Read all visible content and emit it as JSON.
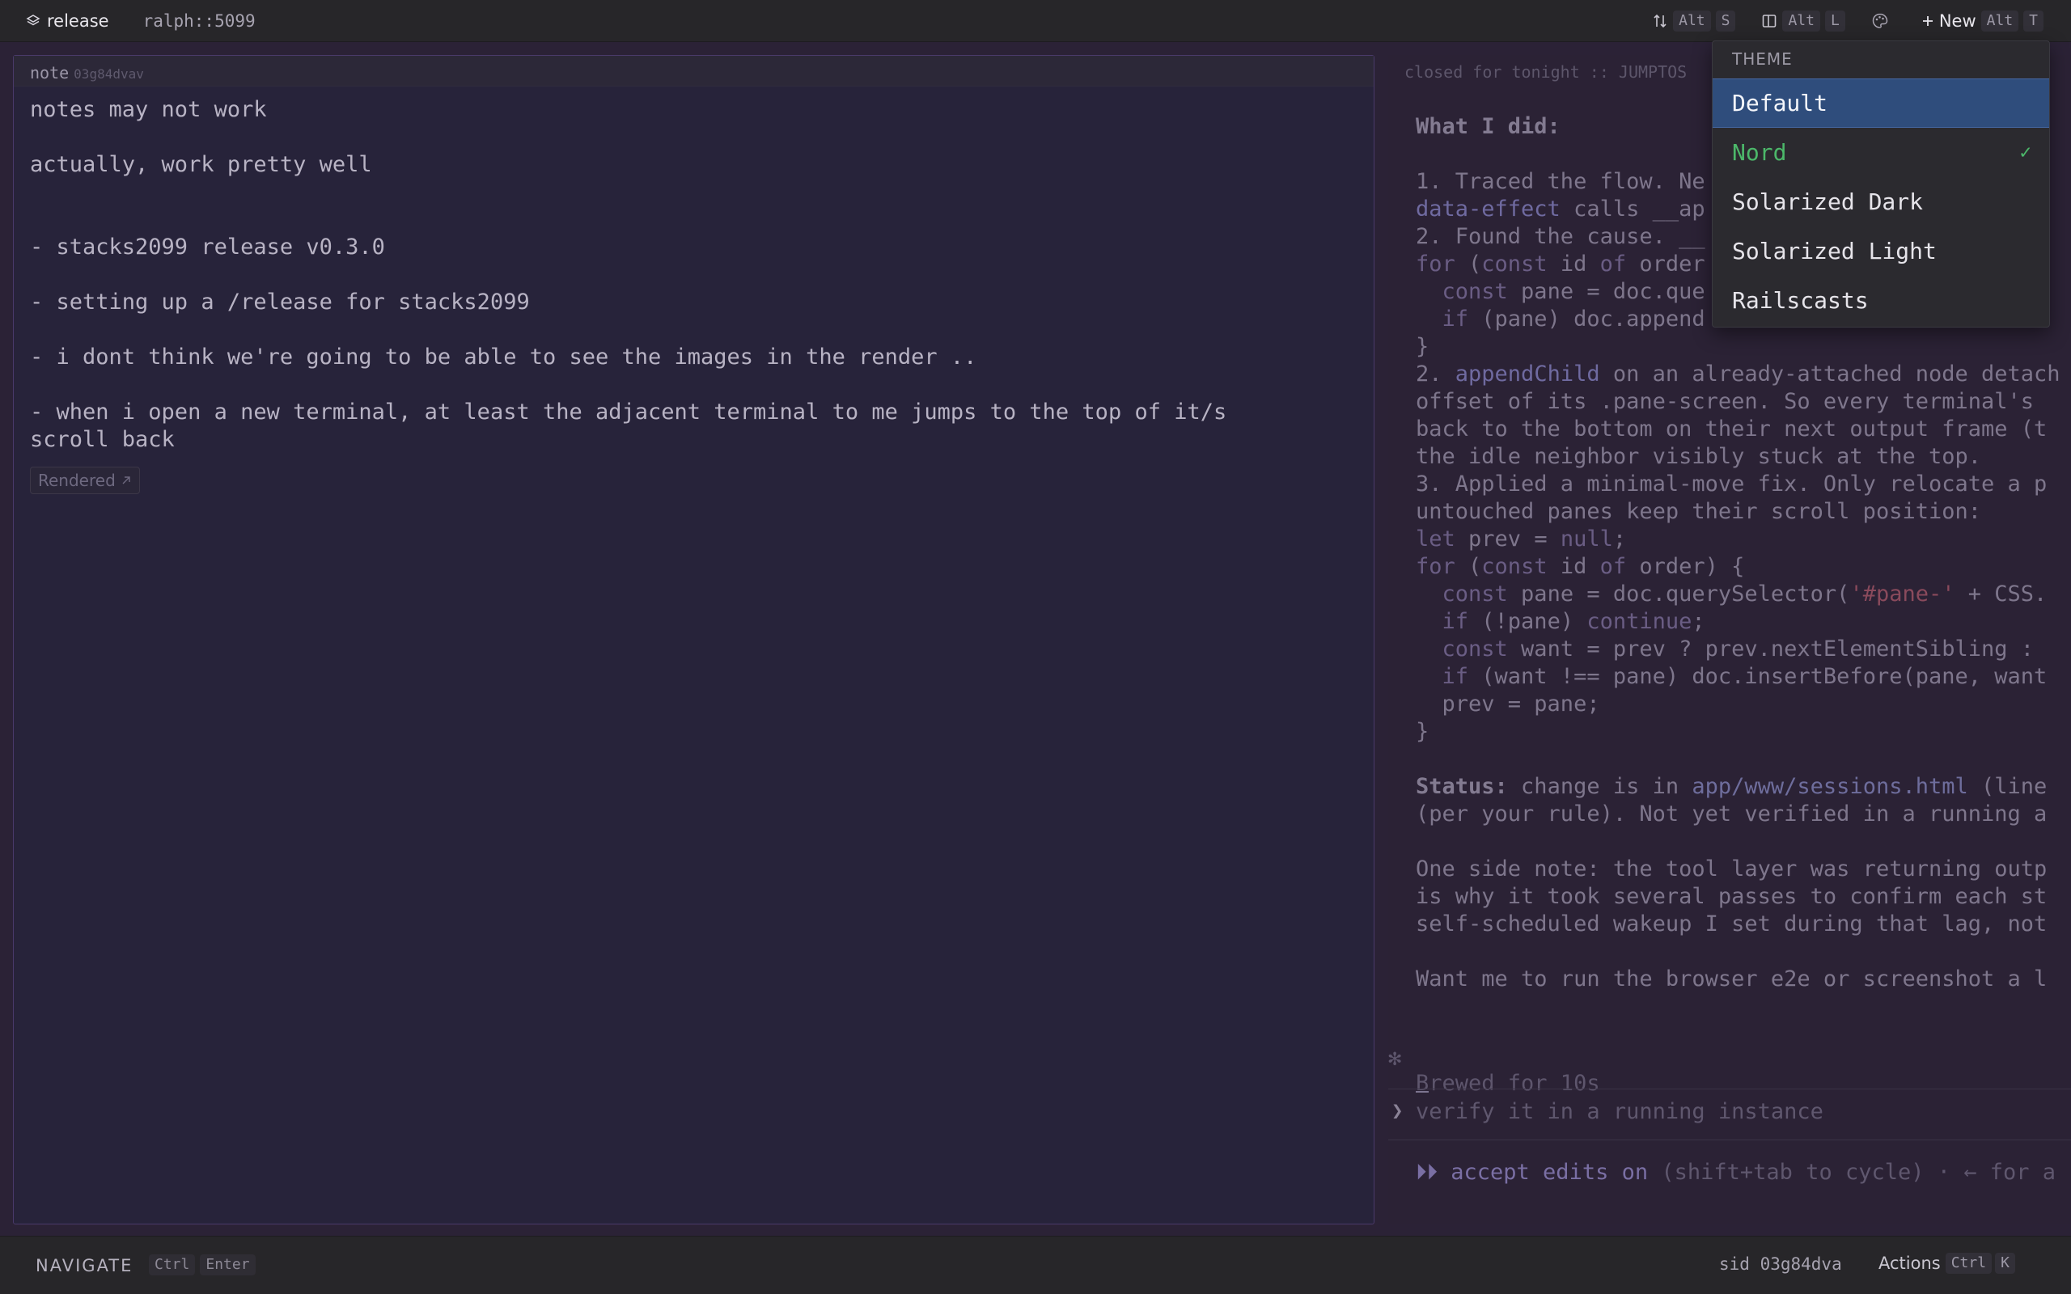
{
  "topbar": {
    "project": "release",
    "session": "ralph::5099",
    "sort": {
      "icon": "sort-arrows-icon",
      "keys": [
        "Alt",
        "S"
      ]
    },
    "layout": {
      "icon": "split-layout-icon",
      "keys": [
        "Alt",
        "L"
      ]
    },
    "theme": {
      "icon": "palette-icon"
    },
    "new": {
      "label": "New",
      "keys": [
        "Alt",
        "T"
      ]
    }
  },
  "note": {
    "label": "note",
    "id": "03g84dvav",
    "lines": [
      "notes may not work",
      "actually, work pretty well",
      "- stacks2099 release v0.3.0",
      "- setting up a /release for stacks2099",
      "- i dont think we're going to be able to see the images in the render ..",
      "- when i open a new terminal, at least the adjacent terminal to me jumps to the top of it/s",
      "scroll back"
    ],
    "rendered_label": "Rendered"
  },
  "terminal": {
    "header": "closed for tonight :: JUMPTOS",
    "brewed": "Brewed for 10s",
    "input_placeholder": "verify it in a running instance",
    "accept_edits": "accept edits on",
    "accept_hint": "(shift+tab to cycle) · ← for a"
  },
  "theme_menu": {
    "heading": "THEME",
    "items": [
      {
        "label": "Default",
        "state": "highlighted"
      },
      {
        "label": "Nord",
        "state": "current"
      },
      {
        "label": "Solarized Dark",
        "state": ""
      },
      {
        "label": "Solarized Light",
        "state": ""
      },
      {
        "label": "Railscasts",
        "state": ""
      }
    ],
    "check": "✓"
  },
  "bottombar": {
    "mode": "NAVIGATE",
    "mode_keys": [
      "Ctrl",
      "Enter"
    ],
    "sid_label": "sid 03g84dva",
    "actions_label": "Actions",
    "actions_keys": [
      "Ctrl",
      "K"
    ]
  },
  "colors": {
    "accent_blue": "#2f4d7c",
    "current_green": "#4cb86a",
    "pane_border": "#4a3a6a"
  }
}
